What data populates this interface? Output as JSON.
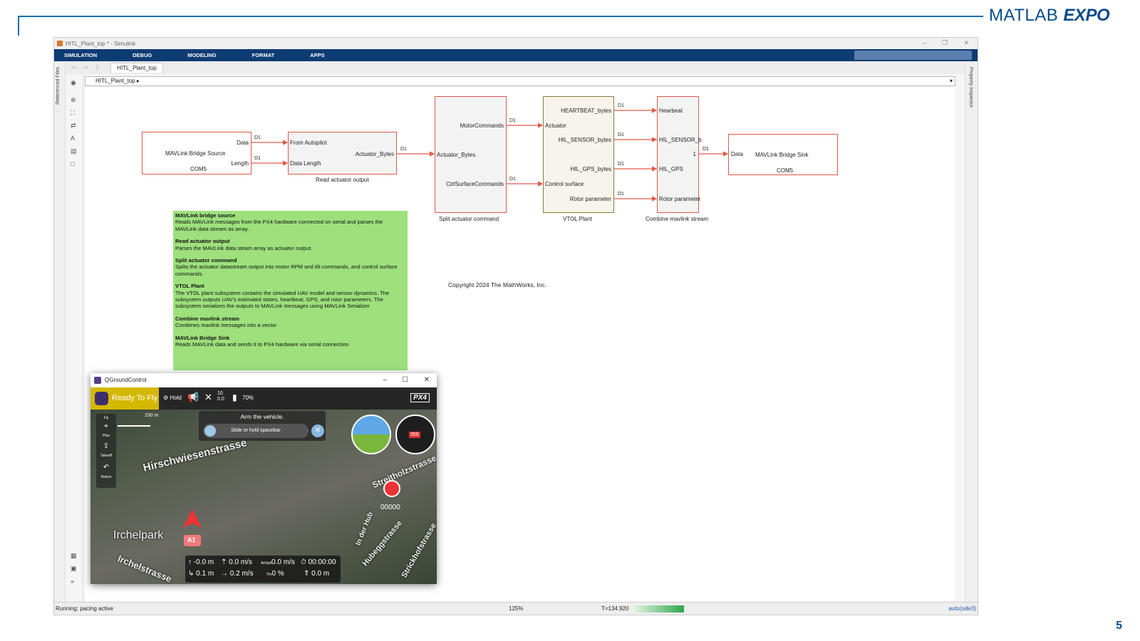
{
  "slide": {
    "logo_plain": "MATLAB",
    "logo_bold": "EXPO",
    "page_number": "5"
  },
  "window": {
    "title": "HITL_Plant_top * - Simulink"
  },
  "ribbon": {
    "tabs": [
      "SIMULATION",
      "DEBUG",
      "MODELING",
      "FORMAT",
      "APPS"
    ]
  },
  "tabstrip": {
    "file_tab": "HITL_Plant_top"
  },
  "address": {
    "path": "HITL_Plant_top ▸"
  },
  "side_panels": {
    "left": "Referenced Files",
    "right": "Property Inspector"
  },
  "blocks": {
    "bridge_source": {
      "name": "MAVLink Bridge Source",
      "sub": "COM5",
      "out_data": "Data",
      "out_length": "Length"
    },
    "read_actuator": {
      "in1": "From Autopilot",
      "in2": "Data Length",
      "out": "Actuator_Bytes",
      "label": "Read actuator output"
    },
    "split": {
      "in": "Actuator_Bytes",
      "out1": "MotorCommands",
      "out2": "CtrlSurfaceCommands",
      "label": "Split actuator command"
    },
    "vtol": {
      "in1": "Actuator",
      "in2": "Control surface",
      "out1": "HEARTBEAT_bytes",
      "out2": "HIL_SENSOR_bytes",
      "out3": "HIL_GPS_bytes",
      "out4": "Rotor parameter",
      "label": "VTOL Plant"
    },
    "combine": {
      "in1": "Hearbeat",
      "in2": "HIL_SENSOR_b",
      "in3": "HIL_GPS",
      "in4": "Rotor parameter",
      "out_num": "1",
      "label": "Combine mavlink stream"
    },
    "bridge_sink": {
      "in": "Data",
      "name": "MAVLink Bridge Sink",
      "sub": "COM5"
    },
    "signal": "D1"
  },
  "note": {
    "sections": [
      {
        "title": "MAVLink bridge source",
        "body": "Reads MAVLink messages from the PX4 hardware connected on serial and parses the MAVLink data stream as array."
      },
      {
        "title": "Read actuator output",
        "body": "Parses the MAVLink data steam array as actuator output."
      },
      {
        "title": "Split actuator command",
        "body": "Splits the actuator datastream output into motor RPM and tilt commands, and control surface commands."
      },
      {
        "title": "VTOL Plant",
        "body": "The VTOL plant subsystem contains the simulated UAV model and sensor dynamics. The subsystem outputs UAV's estimated states, heartbeat, GPS, and rotor parameters. The subsystem serializes the outputs to MAVLink messages using MAVLink Serializer"
      },
      {
        "title": "Combine mavlink stream",
        "body": "Combines mavlink messages into a vector"
      },
      {
        "title": "MAVLink Bridge Sink",
        "body": "Reads MAVLink data and sends it to PX4 hardware via serial connection"
      }
    ]
  },
  "copyright": "Copyright 2024 The MathWorks, Inc.",
  "status": {
    "left": "Running: pacing active",
    "zoom": "125%",
    "time": "T=134.920",
    "solver": "auto(ode3)"
  },
  "qgc": {
    "title": "QGroundControl",
    "ready": "Ready To Fly",
    "mode": "Hold",
    "sats_top": "10",
    "sats_bottom": "0.0",
    "battery": "70%",
    "brand": "PX4",
    "tools": [
      "Fly",
      "Plan",
      "Takeoff",
      "Return"
    ],
    "scale": "150 m",
    "arm_title": "Arm the vehicle.",
    "arm_slider": "Slide or hold spacebar",
    "compass_heading": "356",
    "record_time": "00000",
    "streets": [
      "Hirschwiesenstrasse",
      "Irchelpark",
      "Irchelstrasse",
      "Streitholzstrasse",
      "Hubeggstrasse",
      "Strickhofstrasse",
      "In der Hub"
    ],
    "vehicle_label": "A1",
    "telemetry": {
      "alt_rel": "-0.0 m",
      "vspeed": "0.0 m/s",
      "airspeed_label": "AirSpd",
      "airspeed": "0.0 m/s",
      "flight_time": "00:00:00",
      "dist": "0.1 m",
      "hspeed": "0.2 m/s",
      "throttle_label": "Thr",
      "throttle": "0 %",
      "alt_msl": "0.0 m"
    }
  }
}
